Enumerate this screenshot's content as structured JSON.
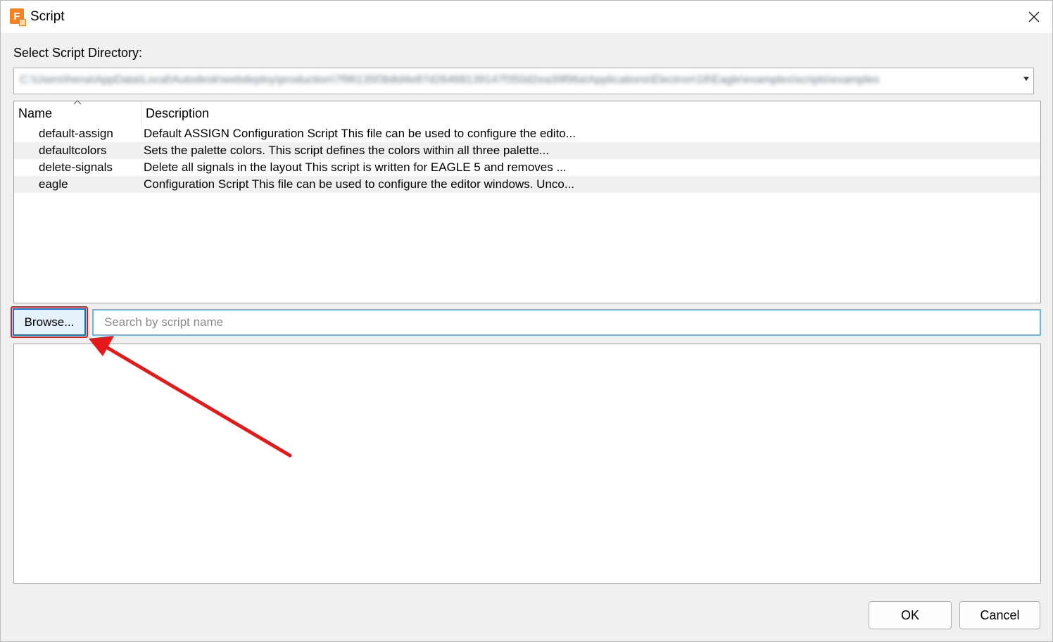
{
  "window": {
    "title": "Script",
    "app_icon": "fusion-eagle-icon",
    "app_icon_letter": "F",
    "close_icon": "close-icon"
  },
  "directory": {
    "label": "Select Script Directory:",
    "path": "C:\\Users\\hena\\AppData\\Local\\Autodesk\\webdeploy\\production\\7f96135f3b8d4e87d26468139147f350d2ea39f96a\\Applications\\Electron\\18\\Eagle\\examples\\scripts\\examples",
    "dropdown_icon": "chevron-down-icon"
  },
  "table": {
    "columns": [
      "Name",
      "Description"
    ],
    "sort_icon": "sort-ascending-icon",
    "rows": [
      {
        "name": "default-assign",
        "description": "Default ASSIGN Configuration Script This file can be used to configure the edito..."
      },
      {
        "name": "defaultcolors",
        "description": "Sets the palette colors. This script defines the colors within all three palette..."
      },
      {
        "name": "delete-signals",
        "description": "Delete all signals in the layout This script is written for EAGLE 5 and removes ..."
      },
      {
        "name": "eagle",
        "description": "Configuration Script This file can be used to configure the editor windows. Unco..."
      }
    ]
  },
  "browse": {
    "label": "Browse..."
  },
  "search": {
    "placeholder": "Search by script name",
    "value": ""
  },
  "buttons": {
    "ok": "OK",
    "cancel": "Cancel"
  },
  "colors": {
    "accent": "#0078d7",
    "annotation_red": "#e41a1a",
    "app_icon_orange": "#f58220"
  }
}
